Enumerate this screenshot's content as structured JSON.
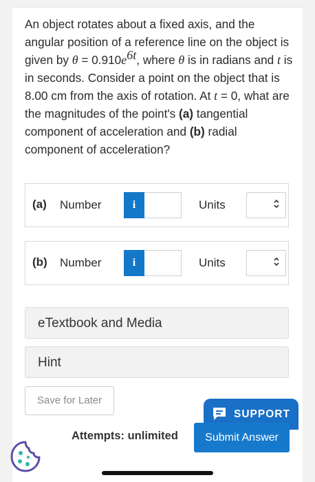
{
  "question": {
    "p1": "An object rotates about a fixed axis, and the angular position of a reference line on the object is given by ",
    "theta": "θ",
    "eq_rest": " = 0.910",
    "e": "e",
    "exponent": "6t",
    "p2": ", where ",
    "theta2": "θ",
    "p3": " is in radians and ",
    "t": "t",
    "p4": " is in seconds. Consider a point on the object that is 8.00 cm from the axis of rotation. At ",
    "t2": "t",
    "p5": " = 0, what are the magnitudes of the point's ",
    "part_a": "(a)",
    "p6": " tangential component of acceleration and ",
    "part_b": "(b)",
    "p7": " radial component of acceleration?"
  },
  "answers": [
    {
      "part": "(a)",
      "number_label": "Number",
      "info_icon": "i",
      "value": "",
      "units_label": "Units",
      "units_value": ""
    },
    {
      "part": "(b)",
      "number_label": "Number",
      "info_icon": "i",
      "value": "",
      "units_label": "Units",
      "units_value": ""
    }
  ],
  "resources": {
    "etextbook_label": "eTextbook and Media",
    "hint_label": "Hint"
  },
  "footer": {
    "save_label": "Save for Later",
    "support_label": "SUPPORT",
    "attempts_label": "Attempts: unlimited",
    "submit_label": "Submit Answer"
  },
  "icons": {
    "support": "chat-bubble-icon",
    "cookie": "cookie-icon",
    "select": "chevron-updown-icon"
  },
  "colors": {
    "primary": "#1679cc",
    "info": "#1478c9",
    "support": "#1a6fc6",
    "cookie": "#5a4fa8"
  }
}
